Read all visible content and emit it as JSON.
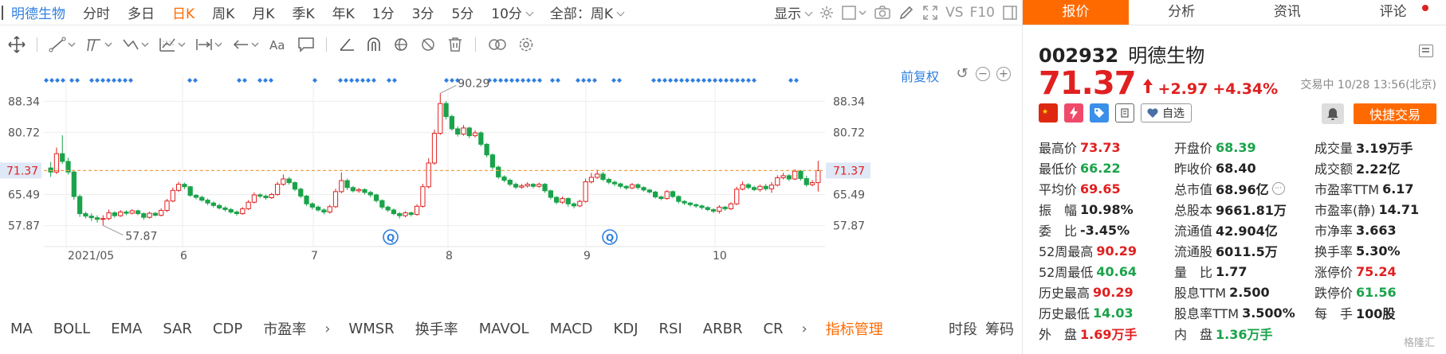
{
  "period_bar": {
    "stock_name": "明德生物",
    "tabs": [
      "分时",
      "多日",
      "日K",
      "周K",
      "月K",
      "季K",
      "年K",
      "1分",
      "3分",
      "5分",
      "10分"
    ],
    "active_tab": "日K",
    "range_select": "全部：周K",
    "display_menu": "显示",
    "vs_label": "VS",
    "f10_label": "F10"
  },
  "chart": {
    "adjust_label": "前复权",
    "price_axis_left": [
      "88.34",
      "80.72",
      "65.49",
      "57.87"
    ],
    "price_axis_right": [
      "88.34",
      "80.72",
      "65.49",
      "57.87"
    ],
    "current_price_tag": "71.37",
    "max_label": "90.29",
    "min_label": "57.87",
    "dates": [
      "2021/05",
      "6",
      "7",
      "8",
      "9",
      "10"
    ]
  },
  "chart_data": {
    "type": "candlestick",
    "y_ticks": [
      57.87,
      65.49,
      73.1,
      80.72,
      88.34
    ],
    "ylim": [
      53.5,
      92.5
    ],
    "reference_line": 71.37,
    "high_label": 90.29,
    "low_label": 57.87,
    "x_labels": [
      "2021/05",
      "6",
      "7",
      "8",
      "9",
      "10"
    ],
    "candles": [
      [
        72.0,
        71.0,
        73.5,
        69.8
      ],
      [
        71.0,
        75.5,
        77.0,
        70.5
      ],
      [
        75.5,
        73.6,
        80.0,
        73.0
      ],
      [
        73.6,
        71.0,
        74.5,
        70.4
      ],
      [
        71.0,
        65.0,
        71.5,
        64.2
      ],
      [
        65.0,
        60.8,
        65.5,
        60.0
      ],
      [
        60.8,
        60.2,
        61.3,
        59.6
      ],
      [
        60.2,
        59.8,
        60.9,
        59.0
      ],
      [
        59.8,
        59.4,
        60.4,
        58.6
      ],
      [
        59.4,
        59.6,
        60.4,
        57.9
      ],
      [
        59.6,
        61.0,
        61.8,
        59.2
      ],
      [
        61.0,
        60.3,
        61.4,
        59.8
      ],
      [
        60.3,
        61.2,
        61.7,
        60.0
      ],
      [
        61.2,
        60.9,
        61.6,
        60.4
      ],
      [
        60.9,
        61.5,
        61.9,
        60.6
      ],
      [
        61.5,
        60.8,
        61.8,
        60.4
      ],
      [
        60.8,
        59.9,
        61.1,
        59.3
      ],
      [
        59.9,
        60.9,
        61.3,
        59.6
      ],
      [
        60.9,
        60.4,
        61.2,
        60.1
      ],
      [
        60.4,
        61.6,
        62.1,
        60.1
      ],
      [
        61.6,
        63.9,
        64.4,
        61.2
      ],
      [
        63.9,
        66.5,
        67.2,
        63.6
      ],
      [
        66.5,
        68.0,
        68.6,
        66.1
      ],
      [
        68.0,
        67.4,
        68.4,
        66.8
      ],
      [
        67.4,
        65.3,
        67.6,
        64.9
      ],
      [
        65.3,
        64.8,
        65.6,
        64.3
      ],
      [
        64.8,
        64.1,
        65.2,
        63.7
      ],
      [
        64.1,
        63.4,
        64.5,
        62.9
      ],
      [
        63.4,
        62.8,
        63.8,
        62.3
      ],
      [
        62.8,
        62.2,
        63.2,
        61.8
      ],
      [
        62.2,
        61.8,
        62.6,
        61.3
      ],
      [
        61.8,
        61.2,
        62.2,
        60.8
      ],
      [
        61.2,
        60.8,
        61.6,
        60.3
      ],
      [
        60.8,
        62.0,
        62.4,
        60.5
      ],
      [
        62.0,
        63.6,
        64.1,
        61.7
      ],
      [
        63.6,
        65.4,
        66.0,
        63.3
      ],
      [
        65.4,
        65.1,
        65.8,
        64.6
      ],
      [
        65.1,
        64.7,
        65.5,
        64.2
      ],
      [
        64.7,
        65.5,
        65.9,
        64.4
      ],
      [
        65.5,
        68.0,
        68.6,
        65.2
      ],
      [
        68.0,
        69.3,
        70.4,
        67.6
      ],
      [
        69.3,
        68.4,
        69.8,
        67.9
      ],
      [
        68.4,
        66.8,
        68.7,
        66.3
      ],
      [
        66.8,
        65.1,
        67.2,
        64.6
      ],
      [
        65.1,
        63.2,
        65.4,
        62.7
      ],
      [
        63.2,
        62.4,
        63.6,
        61.8
      ],
      [
        62.4,
        61.7,
        62.8,
        61.3
      ],
      [
        61.7,
        61.2,
        62.1,
        60.6
      ],
      [
        61.2,
        62.5,
        63.0,
        60.8
      ],
      [
        62.5,
        66.2,
        66.9,
        62.2
      ],
      [
        66.2,
        68.9,
        70.9,
        65.8
      ],
      [
        68.9,
        67.2,
        69.4,
        66.6
      ],
      [
        67.2,
        66.4,
        67.6,
        66.0
      ],
      [
        66.4,
        66.7,
        67.1,
        65.9
      ],
      [
        66.7,
        66.0,
        67.0,
        65.5
      ],
      [
        66.0,
        65.4,
        66.4,
        64.8
      ],
      [
        65.4,
        64.0,
        65.7,
        63.5
      ],
      [
        64.0,
        62.4,
        64.3,
        61.9
      ],
      [
        62.4,
        61.7,
        62.8,
        61.2
      ],
      [
        61.7,
        60.8,
        62.1,
        60.4
      ],
      [
        60.8,
        60.3,
        61.2,
        59.6
      ],
      [
        60.3,
        61.0,
        61.4,
        59.9
      ],
      [
        61.0,
        60.6,
        61.3,
        60.1
      ],
      [
        60.6,
        62.6,
        63.1,
        60.3
      ],
      [
        62.6,
        67.4,
        68.1,
        62.3
      ],
      [
        67.4,
        73.2,
        74.4,
        67.0
      ],
      [
        73.2,
        80.5,
        81.4,
        72.8
      ],
      [
        80.5,
        87.8,
        90.29,
        80.1
      ],
      [
        87.8,
        84.6,
        88.4,
        83.9
      ],
      [
        84.6,
        81.6,
        85.1,
        81.1
      ],
      [
        81.6,
        80.3,
        82.2,
        79.7
      ],
      [
        80.3,
        81.8,
        82.5,
        79.9
      ],
      [
        81.8,
        79.9,
        82.1,
        79.3
      ],
      [
        79.9,
        80.6,
        81.2,
        79.5
      ],
      [
        80.6,
        77.8,
        81.0,
        77.3
      ],
      [
        77.8,
        75.2,
        78.1,
        74.6
      ],
      [
        75.2,
        72.2,
        75.6,
        71.6
      ],
      [
        72.2,
        69.8,
        72.6,
        69.3
      ],
      [
        69.8,
        69.0,
        70.2,
        68.5
      ],
      [
        69.0,
        68.0,
        69.4,
        67.5
      ],
      [
        68.0,
        67.3,
        68.4,
        66.8
      ],
      [
        67.3,
        67.6,
        68.1,
        66.9
      ],
      [
        67.6,
        68.0,
        68.5,
        67.2
      ],
      [
        68.0,
        67.5,
        68.3,
        67.0
      ],
      [
        67.5,
        68.0,
        68.4,
        67.1
      ],
      [
        68.0,
        66.4,
        68.3,
        65.9
      ],
      [
        66.4,
        64.8,
        66.7,
        64.3
      ],
      [
        64.8,
        63.6,
        65.1,
        63.1
      ],
      [
        63.6,
        64.5,
        65.0,
        63.2
      ],
      [
        64.5,
        63.2,
        64.8,
        62.5
      ],
      [
        63.2,
        62.7,
        63.6,
        62.1
      ],
      [
        62.7,
        63.8,
        64.2,
        62.4
      ],
      [
        63.8,
        68.6,
        69.4,
        63.5
      ],
      [
        68.6,
        69.7,
        70.8,
        68.2
      ],
      [
        69.7,
        70.5,
        71.6,
        69.3
      ],
      [
        70.5,
        69.2,
        71.0,
        68.8
      ],
      [
        69.2,
        68.5,
        69.6,
        68.0
      ],
      [
        68.5,
        68.1,
        68.9,
        67.6
      ],
      [
        68.1,
        67.5,
        68.4,
        67.0
      ],
      [
        67.5,
        67.1,
        67.8,
        66.6
      ],
      [
        67.1,
        67.9,
        68.3,
        66.8
      ],
      [
        67.9,
        67.2,
        68.2,
        66.7
      ],
      [
        67.2,
        66.6,
        67.5,
        66.2
      ],
      [
        66.6,
        66.1,
        66.9,
        65.7
      ],
      [
        66.1,
        64.9,
        66.4,
        64.5
      ],
      [
        64.9,
        64.5,
        65.2,
        64.1
      ],
      [
        64.5,
        66.2,
        66.6,
        64.2
      ],
      [
        66.2,
        65.0,
        66.5,
        64.6
      ],
      [
        65.0,
        63.8,
        65.3,
        63.3
      ],
      [
        63.8,
        63.4,
        64.1,
        62.9
      ],
      [
        63.4,
        63.0,
        63.7,
        62.5
      ],
      [
        63.0,
        62.7,
        63.3,
        62.2
      ],
      [
        62.7,
        62.3,
        63.0,
        61.8
      ],
      [
        62.3,
        61.8,
        62.6,
        61.4
      ],
      [
        61.8,
        61.4,
        62.1,
        60.9
      ],
      [
        61.4,
        62.4,
        62.9,
        60.8
      ],
      [
        62.4,
        62.0,
        62.7,
        61.5
      ],
      [
        62.0,
        63.2,
        63.6,
        61.7
      ],
      [
        63.2,
        66.8,
        67.4,
        62.9
      ],
      [
        66.8,
        67.9,
        68.7,
        66.5
      ],
      [
        67.9,
        67.2,
        68.3,
        66.8
      ],
      [
        67.2,
        66.7,
        67.6,
        66.3
      ],
      [
        66.7,
        67.5,
        67.9,
        66.2
      ],
      [
        67.5,
        66.9,
        68.1,
        66.4
      ],
      [
        66.9,
        67.8,
        68.5,
        65.9
      ],
      [
        67.8,
        69.6,
        70.2,
        67.5
      ],
      [
        69.6,
        70.1,
        70.8,
        69.2
      ],
      [
        70.1,
        69.3,
        70.5,
        68.8
      ],
      [
        69.3,
        71.2,
        71.7,
        69.0
      ],
      [
        71.2,
        69.4,
        71.5,
        68.9
      ],
      [
        69.4,
        67.9,
        70.1,
        67.4
      ],
      [
        67.9,
        68.4,
        69.0,
        67.5
      ],
      [
        68.4,
        71.37,
        73.73,
        66.22
      ]
    ]
  },
  "indicators": {
    "tabs": [
      "MA",
      "BOLL",
      "EMA",
      "SAR",
      "CDP",
      "市盈率"
    ],
    "tabs2": [
      "WMSR",
      "换手率",
      "MAVOL",
      "MACD",
      "KDJ",
      "RSI",
      "ARBR",
      "CR"
    ],
    "manage": "指标管理",
    "right_tabs": [
      "时段",
      "筹码"
    ]
  },
  "panel": {
    "tabs": [
      "报价",
      "分析",
      "资讯",
      "评论"
    ],
    "code": "002932",
    "name": "明德生物",
    "price": "71.37",
    "change": "+2.97",
    "change_pct": "+4.34%",
    "status": "交易中 10/28 13:56(北京)",
    "watch": "自选",
    "trade": "快捷交易",
    "colors": {
      "up": "#e02020",
      "down": "#1aa34a",
      "accent": "#ff6a00",
      "link": "#2f7fe0"
    },
    "stats": [
      [
        {
          "l": "最高价",
          "v": "73.73",
          "c": "up"
        },
        {
          "l": "开盘价",
          "v": "68.39",
          "c": "down"
        },
        {
          "l": "成交量",
          "v": "3.19万手",
          "c": "flat"
        }
      ],
      [
        {
          "l": "最低价",
          "v": "66.22",
          "c": "down"
        },
        {
          "l": "昨收价",
          "v": "68.40",
          "c": "flat"
        },
        {
          "l": "成交额",
          "v": "2.22亿",
          "c": "flat"
        }
      ],
      [
        {
          "l": "平均价",
          "v": "69.65",
          "c": "up"
        },
        {
          "l": "总市值",
          "v": "68.96亿",
          "c": "flat"
        },
        {
          "l": "市盈率TTM",
          "v": "6.17",
          "c": "flat"
        }
      ],
      [
        {
          "l": "振　幅",
          "v": "10.98%",
          "c": "flat"
        },
        {
          "l": "总股本",
          "v": "9661.81万",
          "c": "flat"
        },
        {
          "l": "市盈率(静)",
          "v": "14.71",
          "c": "flat"
        }
      ],
      [
        {
          "l": "委　比",
          "v": "-3.45%",
          "c": "flat"
        },
        {
          "l": "流通值",
          "v": "42.904亿",
          "c": "flat"
        },
        {
          "l": "市净率",
          "v": "3.663",
          "c": "flat"
        }
      ],
      [
        {
          "l": "52周最高",
          "v": "90.29",
          "c": "up"
        },
        {
          "l": "流通股",
          "v": "6011.5万",
          "c": "flat"
        },
        {
          "l": "换手率",
          "v": "5.30%",
          "c": "flat"
        }
      ],
      [
        {
          "l": "52周最低",
          "v": "40.64",
          "c": "down"
        },
        {
          "l": "量　比",
          "v": "1.77",
          "c": "flat"
        },
        {
          "l": "涨停价",
          "v": "75.24",
          "c": "up"
        }
      ],
      [
        {
          "l": "历史最高",
          "v": "90.29",
          "c": "up"
        },
        {
          "l": "股息TTM",
          "v": "2.500",
          "c": "flat"
        },
        {
          "l": "跌停价",
          "v": "61.56",
          "c": "down"
        }
      ],
      [
        {
          "l": "历史最低",
          "v": "14.03",
          "c": "down"
        },
        {
          "l": "股息率TTM",
          "v": "3.500%",
          "c": "flat"
        },
        {
          "l": "每　手",
          "v": "100股",
          "c": "flat"
        }
      ],
      [
        {
          "l": "外　盘",
          "v": "1.69万手",
          "c": "up"
        },
        {
          "l": "内　盘",
          "v": "1.36万手",
          "c": "down"
        },
        null
      ]
    ],
    "watermark": "格隆汇"
  }
}
